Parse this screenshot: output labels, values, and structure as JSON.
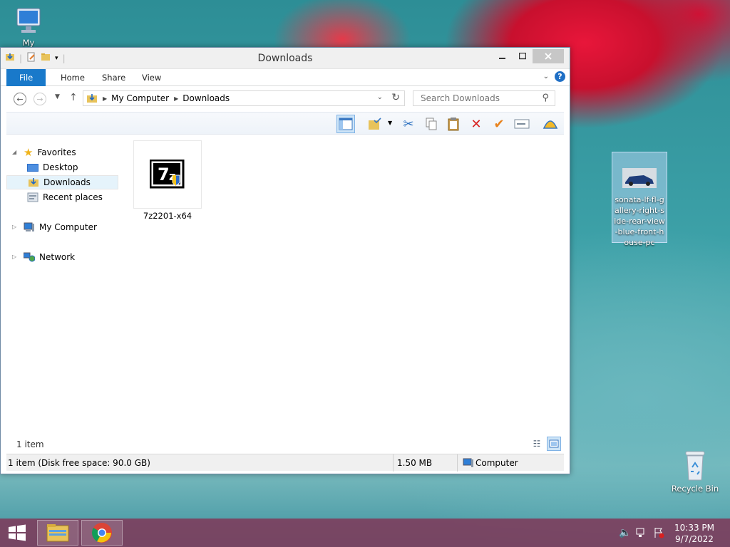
{
  "desktop": {
    "my_computer_label": "My Computer",
    "car_file_label": "sonata-lf-fl-gallery-right-side-rear-view-blue-front-house-pc",
    "recycle_bin_label": "Recycle Bin"
  },
  "window": {
    "title": "Downloads",
    "ribbon_tabs": [
      "File",
      "Home",
      "Share",
      "View"
    ],
    "help_glyph": "?",
    "address": {
      "crumbs": [
        "My Computer",
        "Downloads"
      ]
    },
    "search": {
      "placeholder": "Search Downloads"
    },
    "nav": {
      "favorites": "Favorites",
      "desktop": "Desktop",
      "downloads": "Downloads",
      "recent": "Recent places",
      "my_computer": "My Computer",
      "network": "Network"
    },
    "files": [
      {
        "name": "7z2201-x64",
        "icon": "7zip-installer-icon"
      }
    ],
    "item_count": "1 item",
    "status": {
      "summary": "1 item (Disk free space: 90.0 GB)",
      "size": "1.50 MB",
      "location": "Computer"
    }
  },
  "taskbar": {
    "time": "10:33 PM",
    "date": "9/7/2022"
  },
  "colors": {
    "ribbon_file": "#1979ca",
    "taskbar": "#7e3a5a",
    "selection": "#e5f3fb"
  }
}
